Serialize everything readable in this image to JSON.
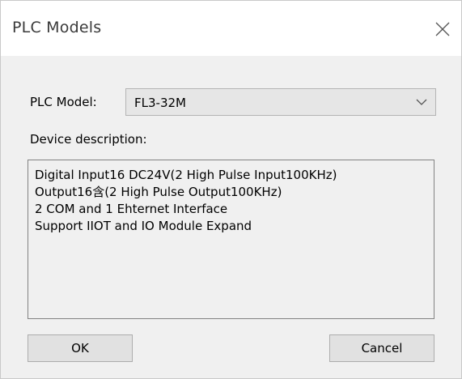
{
  "window": {
    "title": "PLC Models"
  },
  "form": {
    "model_label": "PLC Model:",
    "model_value": "FL3-32M",
    "description_label": "Device description:",
    "description_lines": [
      "Digital Input16 DC24V(2 High Pulse Input100KHz)",
      "Output16含(2 High Pulse Output100KHz)",
      "2 COM and 1 Ehternet Interface",
      "Support IIOT and IO Module Expand"
    ]
  },
  "buttons": {
    "ok_label": "OK",
    "cancel_label": "Cancel"
  },
  "icons": {
    "close": "close-icon",
    "dropdown": "chevron-down-icon"
  },
  "colors": {
    "client_bg": "#f0f0f0",
    "button_bg": "#e1e1e1"
  }
}
